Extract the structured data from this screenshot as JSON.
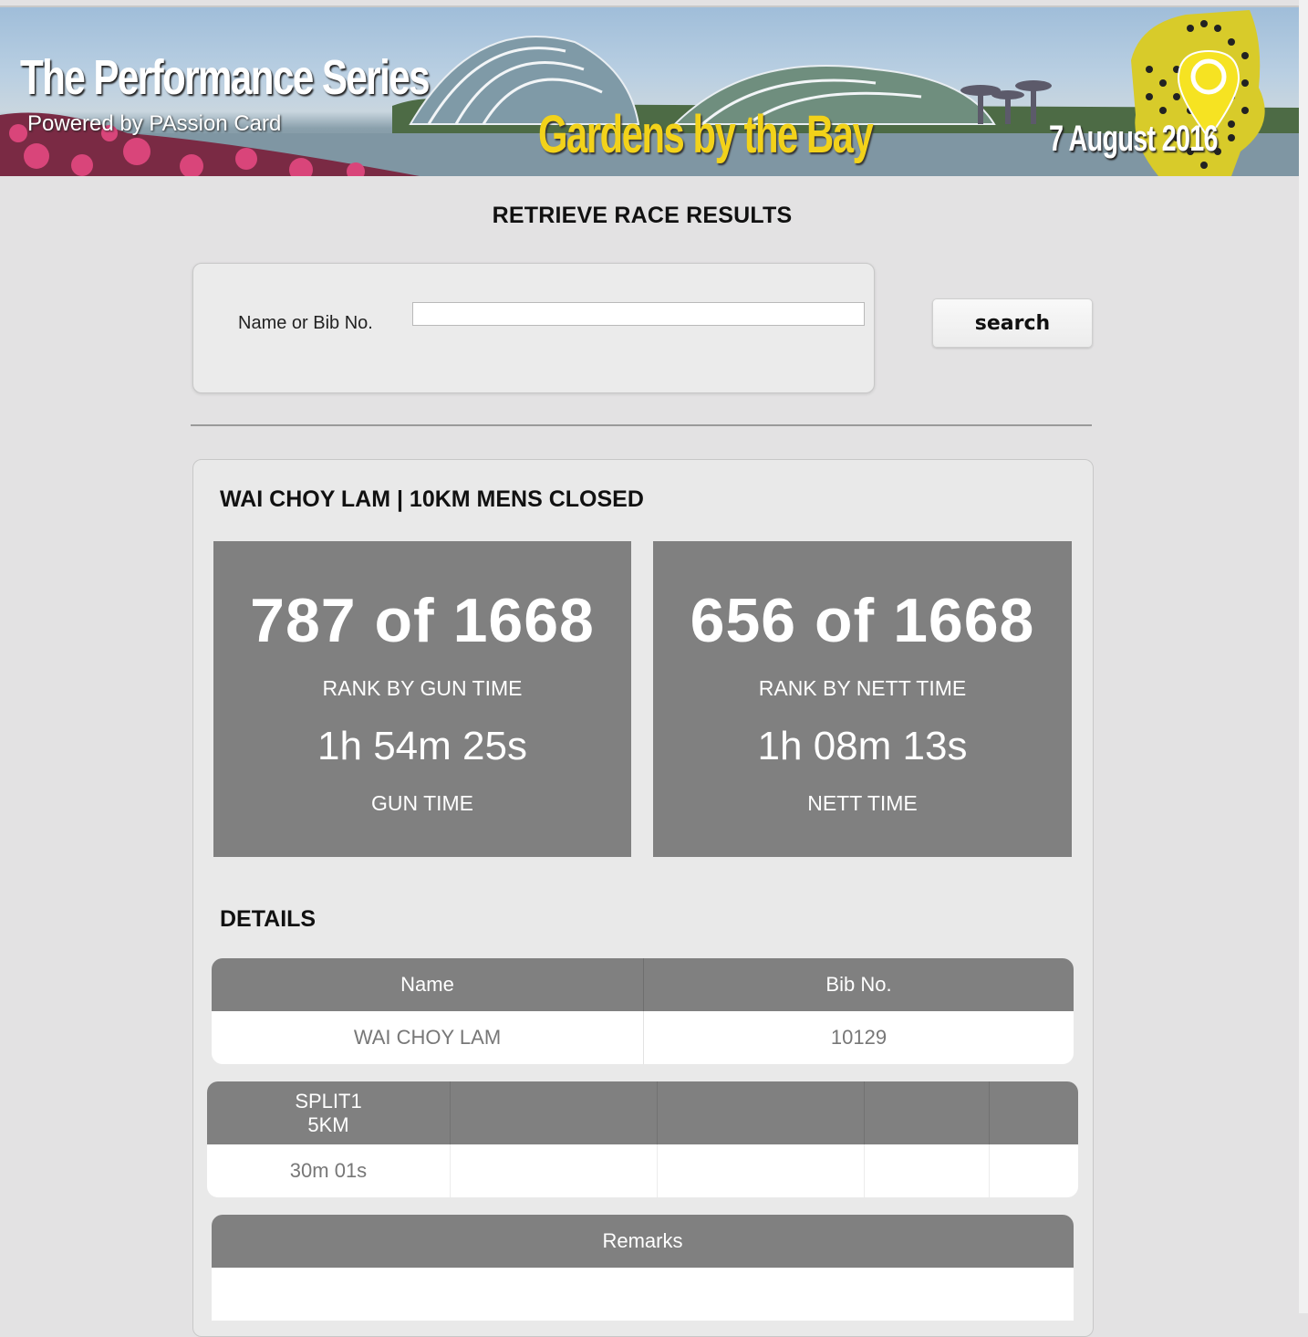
{
  "banner": {
    "series_title": "The Performance Series",
    "powered_by": "Powered by PAssion Card",
    "venue": "Gardens by the Bay",
    "date": "7 August 2016"
  },
  "page": {
    "title": "RETRIEVE RACE RESULTS"
  },
  "search": {
    "label": "Name or Bib No.",
    "value": "",
    "button_label": "search"
  },
  "result": {
    "heading": "WAI CHOY LAM | 10KM MENS CLOSED",
    "gun": {
      "rank": "787 of 1668",
      "rank_label": "RANK BY GUN TIME",
      "time": "1h 54m 25s",
      "time_label": "GUN TIME"
    },
    "nett": {
      "rank": "656 of 1668",
      "rank_label": "RANK BY NETT TIME",
      "time": "1h 08m 13s",
      "time_label": "NETT TIME"
    }
  },
  "details": {
    "heading": "DETAILS",
    "columns": [
      "Name",
      "Bib No."
    ],
    "row": [
      "WAI CHOY LAM",
      "10129"
    ]
  },
  "splits": {
    "columns": [
      {
        "line1": "SPLIT1",
        "line2": "5KM"
      },
      {
        "line1": "",
        "line2": ""
      },
      {
        "line1": "",
        "line2": ""
      },
      {
        "line1": "",
        "line2": ""
      },
      {
        "line1": "",
        "line2": ""
      }
    ],
    "row": [
      "30m 01s",
      "",
      "",
      "",
      ""
    ]
  },
  "remarks": {
    "header": "Remarks",
    "value": ""
  },
  "colors": {
    "background": "#e3e2e3",
    "card": "#808080",
    "venue_text": "#f2d21a"
  }
}
